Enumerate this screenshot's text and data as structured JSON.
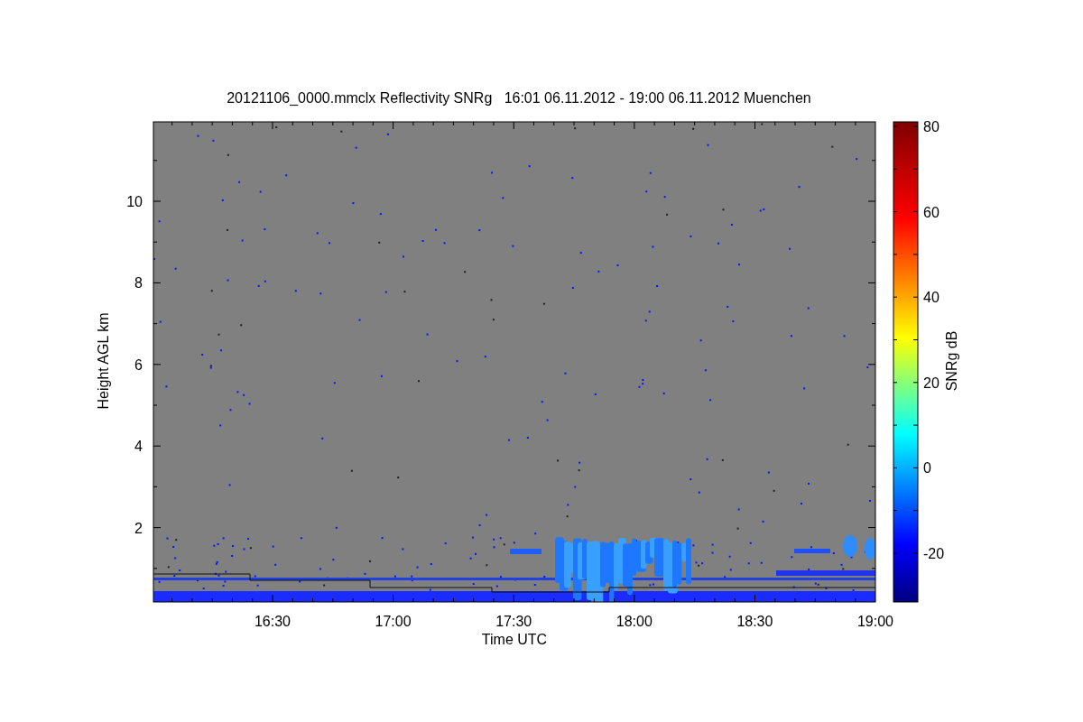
{
  "title": "20121106_0000.mmclx Reflectivity SNRg   16:01 06.11.2012 - 19:00 06.11.2012 Muenchen",
  "y_axis": {
    "label": "Height AGL km",
    "ticks": [
      "10",
      "8",
      "6",
      "4",
      "2"
    ]
  },
  "x_axis": {
    "label": "Time UTC",
    "ticks": [
      "16:30",
      "17:00",
      "17:30",
      "18:00",
      "18:30",
      "19:00"
    ]
  },
  "colorbar": {
    "label": "SNRg dB",
    "ticks": [
      "80",
      "60",
      "40",
      "20",
      "0",
      "-20"
    ]
  }
}
